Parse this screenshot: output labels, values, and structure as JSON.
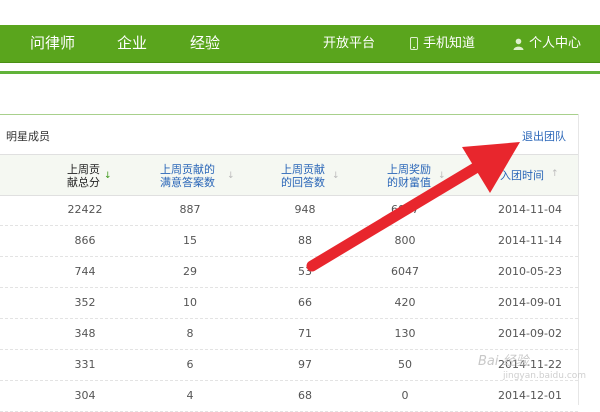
{
  "nav": {
    "left_items": [
      "问律师",
      "企业",
      "经验"
    ],
    "right_items": [
      "开放平台",
      "手机知道",
      "个人中心"
    ],
    "accent_color": "#5aa51d"
  },
  "panel": {
    "title": "明星成员",
    "quit_link": "退出团队"
  },
  "table": {
    "headers": [
      {
        "line1": "上周贡",
        "line2": "献总分",
        "sorted": true
      },
      {
        "line1": "上周贡献的",
        "line2": "满意答案数",
        "sorted": false
      },
      {
        "line1": "上周贡献",
        "line2": "的回答数",
        "sorted": false
      },
      {
        "line1": "上周奖励",
        "line2": "的财富值",
        "sorted": false
      },
      {
        "line1": "入团时间",
        "line2": "",
        "sorted": false
      }
    ],
    "rows": [
      [
        "22422",
        "887",
        "948",
        "6047",
        "2014-11-04"
      ],
      [
        "866",
        "15",
        "88",
        "800",
        "2014-11-14"
      ],
      [
        "744",
        "29",
        "53",
        "6047",
        "2010-05-23"
      ],
      [
        "352",
        "10",
        "66",
        "420",
        "2014-09-01"
      ],
      [
        "348",
        "8",
        "71",
        "130",
        "2014-09-02"
      ],
      [
        "331",
        "6",
        "97",
        "50",
        "2014-11-22"
      ],
      [
        "304",
        "4",
        "68",
        "0",
        "2014-12-01"
      ]
    ]
  },
  "overlay": {
    "arrow_color": "#e8262d",
    "watermark": "Bai 经验",
    "watermark_sub": "jingyan.baidu.com"
  }
}
